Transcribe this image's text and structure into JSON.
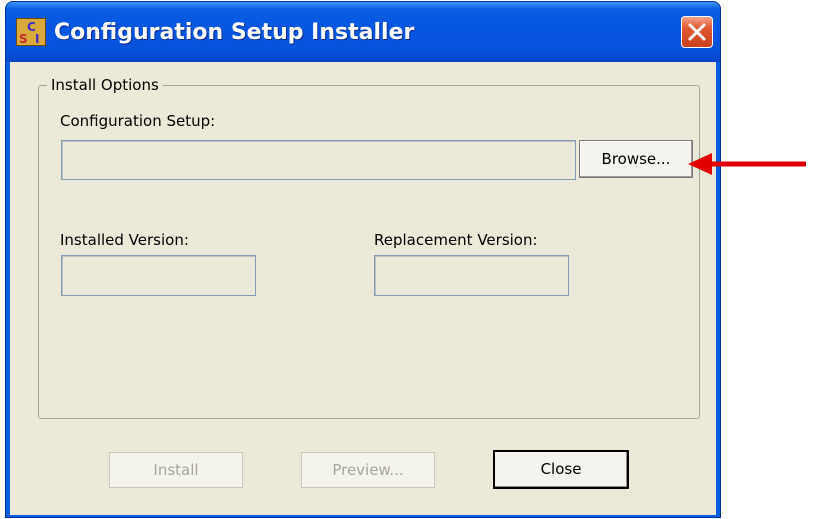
{
  "window": {
    "title": "Configuration Setup Installer",
    "icon_letters": [
      "C",
      "S",
      "I"
    ]
  },
  "group": {
    "legend": "Install Options"
  },
  "config_setup": {
    "label": "Configuration Setup:",
    "value": "",
    "browse_label": "Browse..."
  },
  "installed_version": {
    "label": "Installed Version:",
    "value": ""
  },
  "replacement_version": {
    "label": "Replacement Version:",
    "value": ""
  },
  "buttons": {
    "install": "Install",
    "preview": "Preview...",
    "close": "Close"
  },
  "annotation": {
    "arrow_color": "#e00000"
  },
  "colors": {
    "titlebar": "#0554e3",
    "dialog_face": "#ece9d8",
    "close_button": "#e25a33"
  }
}
